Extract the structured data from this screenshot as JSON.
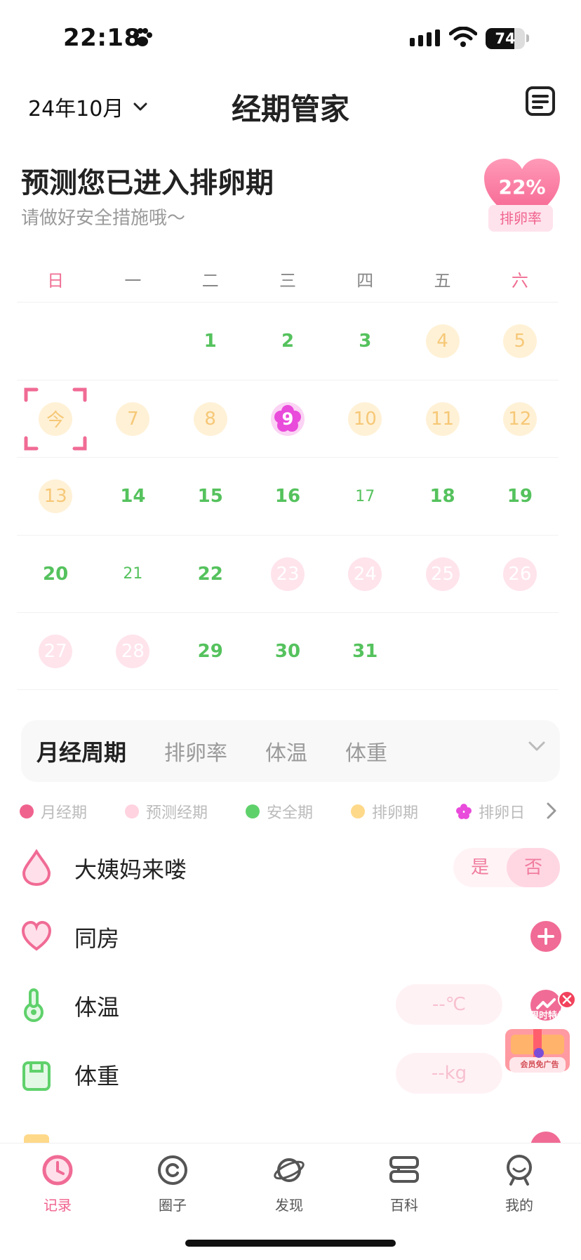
{
  "status_bar": {
    "time": "22:18",
    "battery": "74"
  },
  "header": {
    "month": "24年10月",
    "title": "经期管家"
  },
  "prediction": {
    "headline": "预测您已进入排卵期",
    "subline": "请做好安全措施哦～",
    "rate": "22%",
    "rate_label": "排卵率"
  },
  "calendar": {
    "weekdays": [
      "日",
      "一",
      "二",
      "三",
      "四",
      "五",
      "六"
    ],
    "rows": [
      [
        {
          "label": "",
          "state": "empty"
        },
        {
          "label": "",
          "state": "empty"
        },
        {
          "label": "1",
          "state": "safe"
        },
        {
          "label": "2",
          "state": "safe"
        },
        {
          "label": "3",
          "state": "safe"
        },
        {
          "label": "4",
          "state": "ovulation"
        },
        {
          "label": "5",
          "state": "ovulation"
        }
      ],
      [
        {
          "label": "今",
          "state": "today"
        },
        {
          "label": "7",
          "state": "ovulation"
        },
        {
          "label": "8",
          "state": "ovulation"
        },
        {
          "label": "9",
          "state": "ovulation-day"
        },
        {
          "label": "10",
          "state": "ovulation"
        },
        {
          "label": "11",
          "state": "ovulation"
        },
        {
          "label": "12",
          "state": "ovulation"
        }
      ],
      [
        {
          "label": "13",
          "state": "ovulation"
        },
        {
          "label": "14",
          "state": "safe"
        },
        {
          "label": "15",
          "state": "safe"
        },
        {
          "label": "16",
          "state": "safe"
        },
        {
          "label": "17",
          "state": "safe-thin"
        },
        {
          "label": "18",
          "state": "safe"
        },
        {
          "label": "19",
          "state": "safe"
        }
      ],
      [
        {
          "label": "20",
          "state": "safe"
        },
        {
          "label": "21",
          "state": "safe-thin"
        },
        {
          "label": "22",
          "state": "safe"
        },
        {
          "label": "23",
          "state": "predicted"
        },
        {
          "label": "24",
          "state": "predicted"
        },
        {
          "label": "25",
          "state": "predicted"
        },
        {
          "label": "26",
          "state": "predicted"
        }
      ],
      [
        {
          "label": "27",
          "state": "predicted"
        },
        {
          "label": "28",
          "state": "predicted"
        },
        {
          "label": "29",
          "state": "safe"
        },
        {
          "label": "30",
          "state": "safe"
        },
        {
          "label": "31",
          "state": "safe"
        },
        {
          "label": "",
          "state": "empty"
        },
        {
          "label": "",
          "state": "empty"
        }
      ]
    ]
  },
  "tabs": [
    "月经周期",
    "排卵率",
    "体温",
    "体重"
  ],
  "legend": [
    {
      "label": "月经期",
      "color": "#f0628e",
      "shape": "dot"
    },
    {
      "label": "预测经期",
      "color": "#ffd3e0",
      "shape": "dot"
    },
    {
      "label": "安全期",
      "color": "#5fd16b",
      "shape": "dot"
    },
    {
      "label": "排卵期",
      "color": "#ffd98a",
      "shape": "dot"
    },
    {
      "label": "排卵日",
      "color": "#e94bdb",
      "shape": "flower"
    }
  ],
  "records": {
    "period": {
      "label": "大姨妈来喽",
      "yes": "是",
      "no": "否"
    },
    "intimacy": {
      "label": "同房"
    },
    "temperature": {
      "label": "体温",
      "placeholder": "--℃"
    },
    "weight": {
      "label": "体重",
      "placeholder": "--kg"
    }
  },
  "promo": {
    "title": "会员限时特价",
    "label": "会员免广告"
  },
  "nav": [
    {
      "label": "记录",
      "icon": "clock-icon"
    },
    {
      "label": "圈子",
      "icon": "circle-icon"
    },
    {
      "label": "发现",
      "icon": "planet-icon"
    },
    {
      "label": "百科",
      "icon": "book-icon"
    },
    {
      "label": "我的",
      "icon": "profile-icon"
    }
  ],
  "colors": {
    "accent": "#f0628e",
    "safe": "#55c25d",
    "ovulation": "#fff1d6",
    "predicted": "#ffe4ec"
  }
}
